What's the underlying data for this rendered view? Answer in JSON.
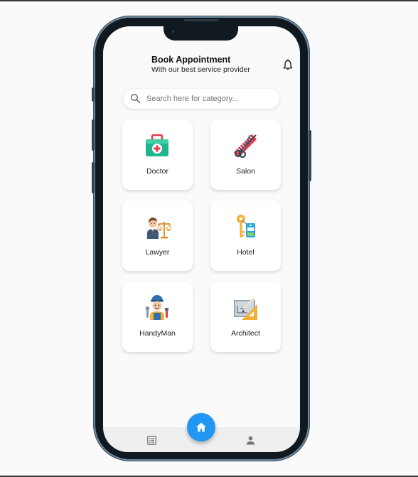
{
  "header": {
    "title": "Book Appointment",
    "subtitle": "With our best service provider"
  },
  "search": {
    "placeholder": "Search here for category..."
  },
  "categories": [
    {
      "label": "Doctor",
      "icon": "first-aid-kit-icon"
    },
    {
      "label": "Salon",
      "icon": "scissors-comb-icon"
    },
    {
      "label": "Lawyer",
      "icon": "lawyer-scales-icon"
    },
    {
      "label": "Hotel",
      "icon": "hotel-key-icon"
    },
    {
      "label": "HandyMan",
      "icon": "handyman-worker-icon"
    },
    {
      "label": "Architect",
      "icon": "blueprint-ruler-icon"
    }
  ],
  "nav": {
    "items": [
      "list-icon",
      "home-icon",
      "person-icon"
    ],
    "active": "home-icon"
  },
  "colors": {
    "accent": "#2196f3",
    "background": "#fafafa",
    "card": "#ffffff",
    "phone_frame": "#101820"
  }
}
